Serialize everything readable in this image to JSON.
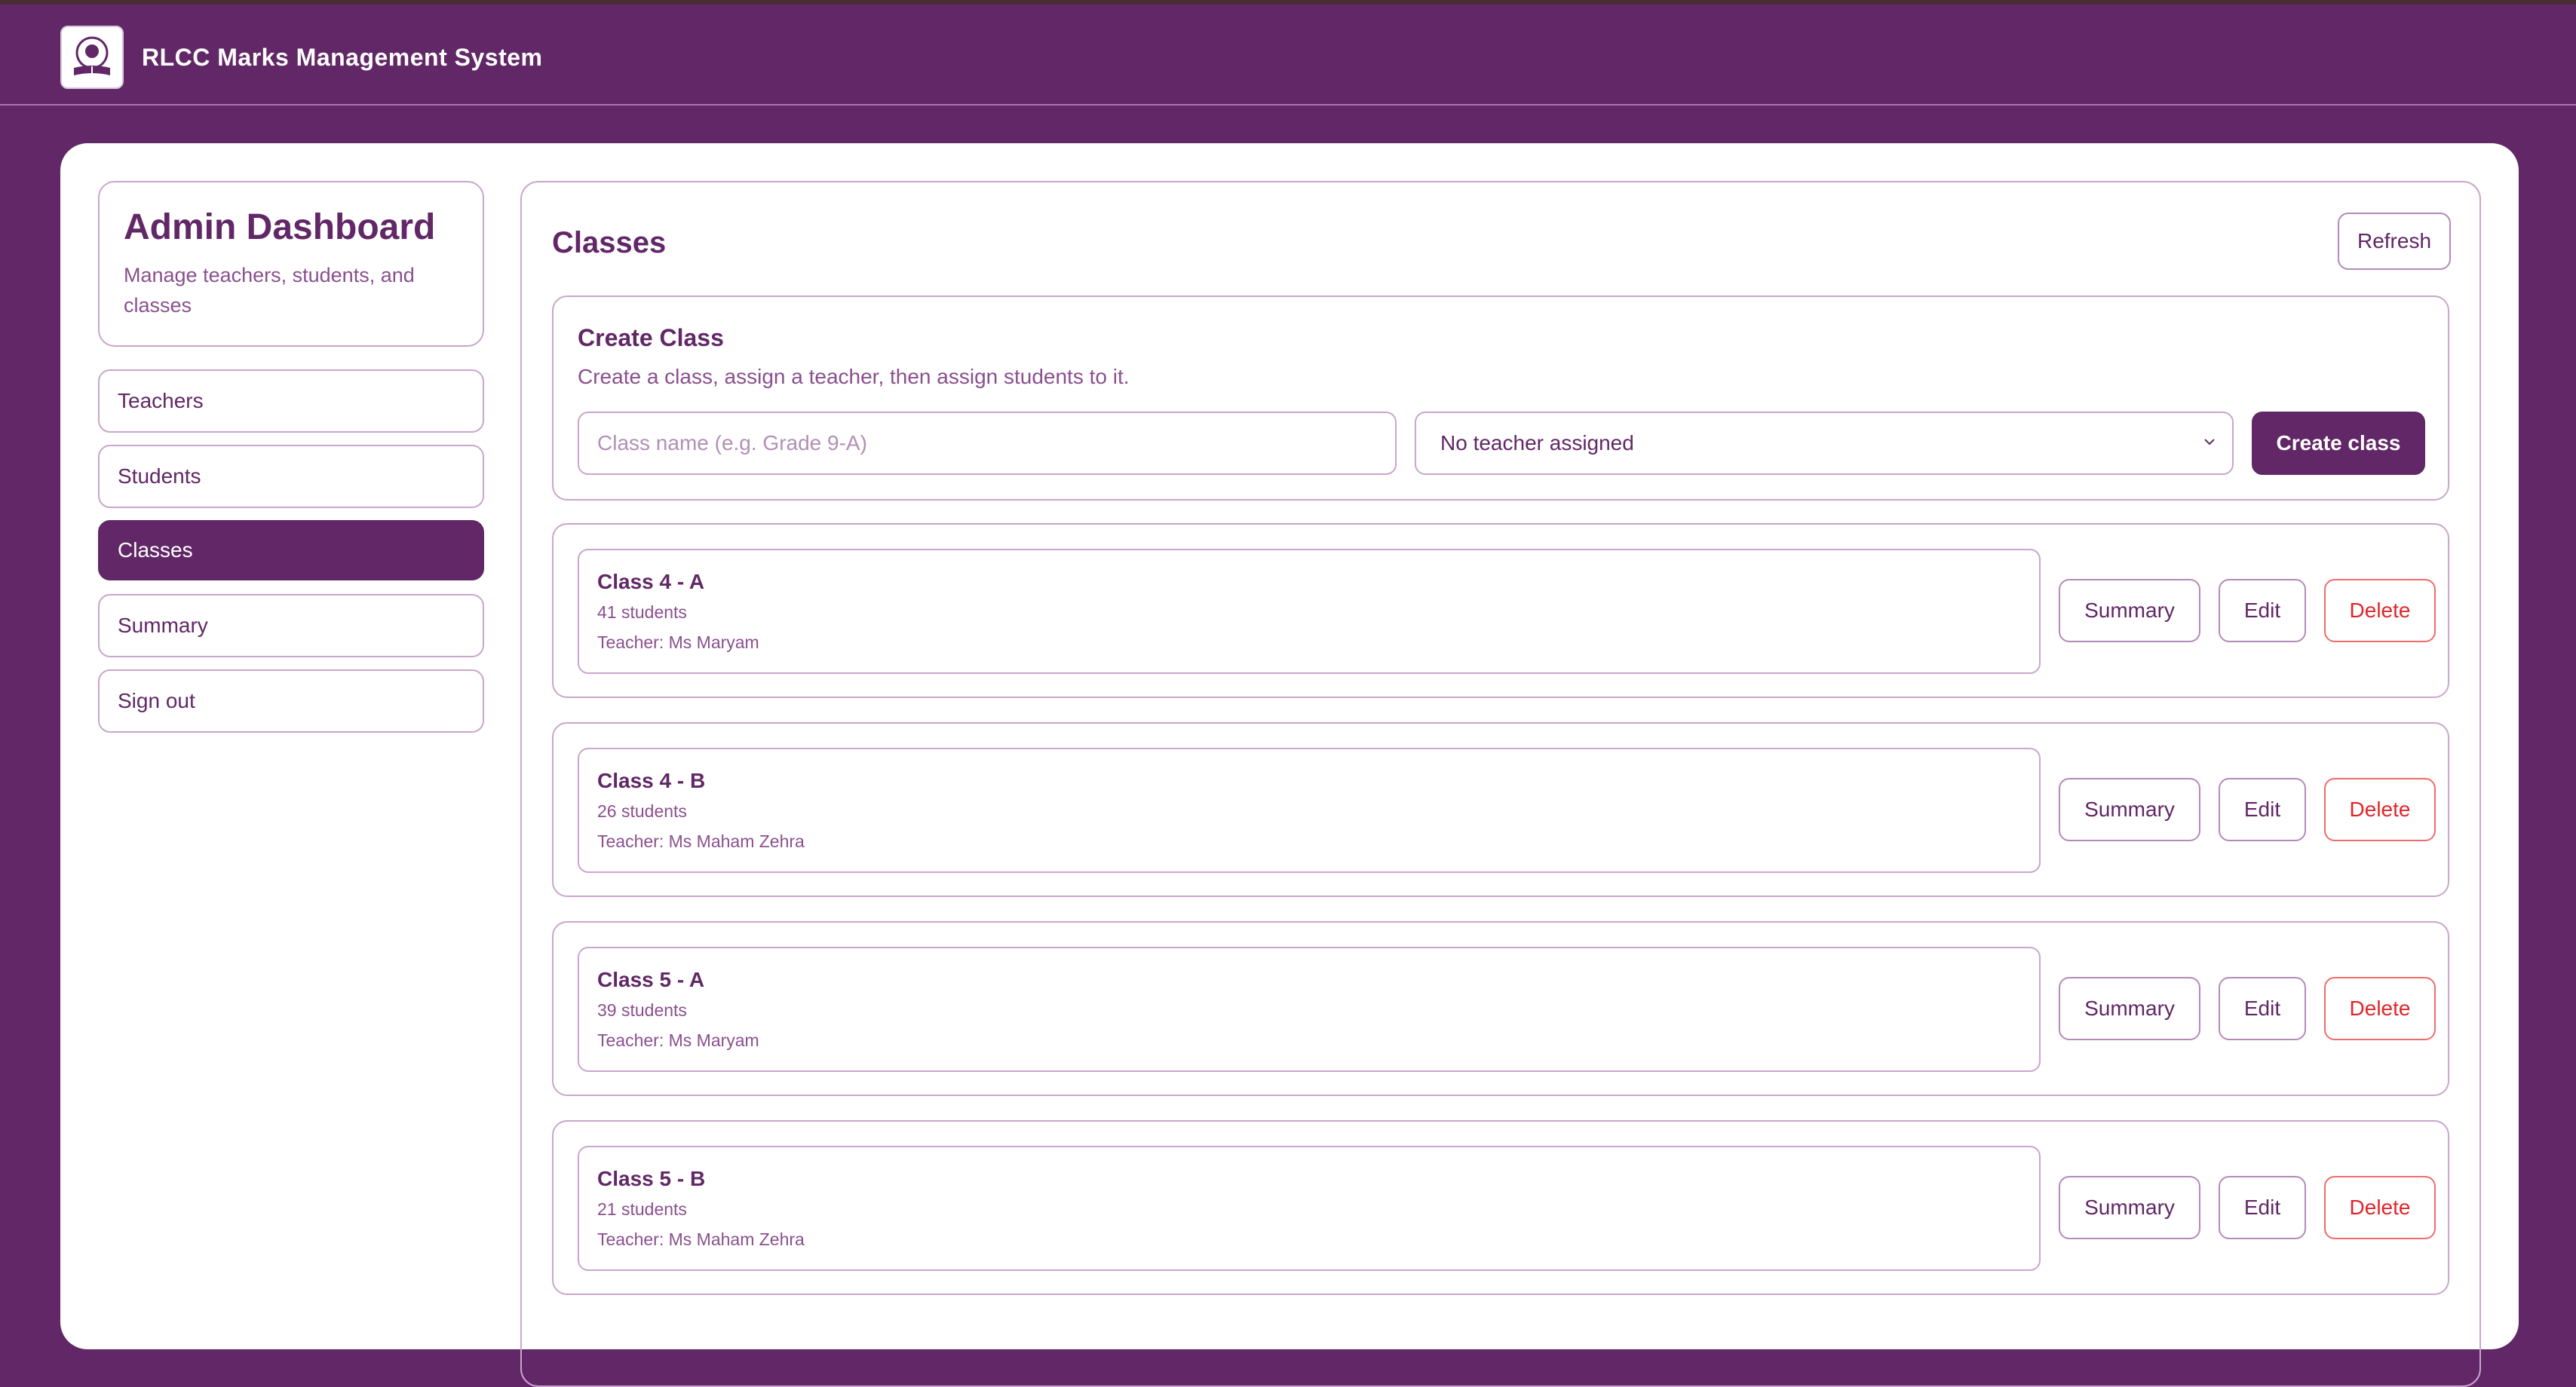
{
  "app": {
    "title": "RLCC Marks Management System",
    "logo": "school-crest-icon"
  },
  "sidebar": {
    "title": "Admin Dashboard",
    "subtitle": "Manage teachers, students, and classes",
    "items": [
      {
        "label": "Teachers",
        "active": false
      },
      {
        "label": "Students",
        "active": false
      },
      {
        "label": "Classes",
        "active": true
      },
      {
        "label": "Summary",
        "active": false
      },
      {
        "label": "Sign out",
        "active": false
      }
    ]
  },
  "main": {
    "title": "Classes",
    "refresh_label": "Refresh",
    "create": {
      "title": "Create Class",
      "description": "Create a class, assign a teacher, then assign students to it.",
      "name_placeholder": "Class name (e.g. Grade 9-A)",
      "name_value": "",
      "teacher_selected": "No teacher assigned",
      "submit_label": "Create class"
    },
    "classes": [
      {
        "name": "Class 4 - A",
        "students": "41 students",
        "teacher": "Teacher: Ms Maryam"
      },
      {
        "name": "Class 4 - B",
        "students": "26 students",
        "teacher": "Teacher: Ms Maham Zehra"
      },
      {
        "name": "Class 5 - A",
        "students": "39 students",
        "teacher": "Teacher: Ms Maryam"
      },
      {
        "name": "Class 5 - B",
        "students": "21 students",
        "teacher": "Teacher: Ms Maham Zehra"
      }
    ],
    "row_actions": {
      "summary_label": "Summary",
      "edit_label": "Edit",
      "delete_label": "Delete"
    }
  },
  "colors": {
    "brand": "#612766",
    "border": "#c9a6cc",
    "danger": "#e0262b",
    "muted_text": "#8a4f8e"
  }
}
